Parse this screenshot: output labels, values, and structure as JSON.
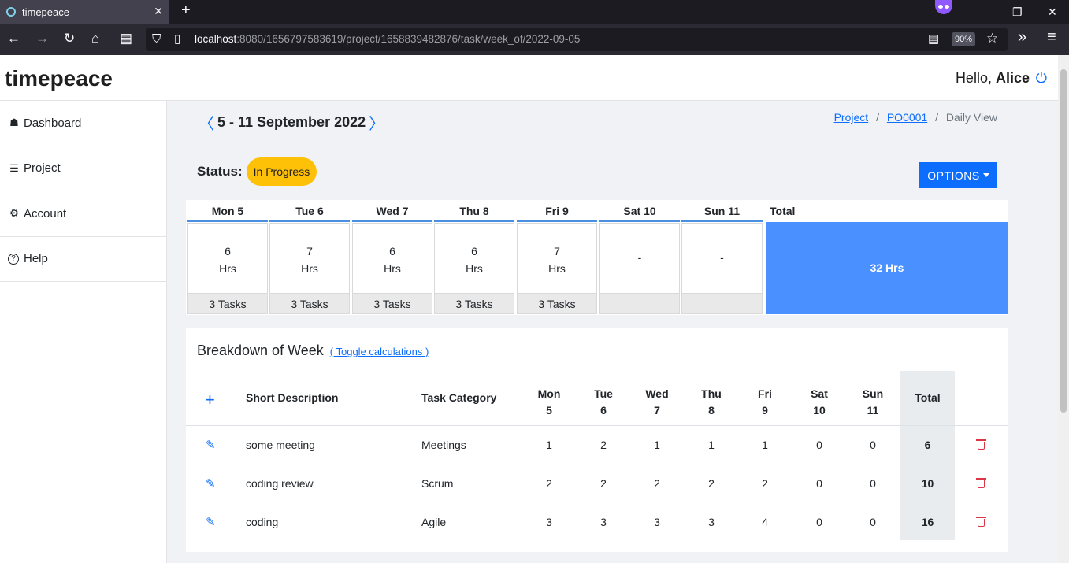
{
  "browser": {
    "tab_title": "timepeace",
    "tab_close": "✕",
    "new_tab": "+",
    "url_host": "localhost",
    "url_rest": ":8080/1656797583619/project/1658839482876/task/week_of/2022-09-05",
    "zoom": "90%",
    "back": "←",
    "forward": "→",
    "reload": "↻",
    "home": "⌂",
    "reader": "▤",
    "shield": "⛉",
    "page": "▯",
    "reader_view": "▤",
    "star": "☆",
    "more": "»",
    "menu": "≡",
    "minimize": "—",
    "restore": "❐",
    "close": "✕"
  },
  "app": {
    "brand": "timepeace",
    "hello": "Hello, ",
    "user": "Alice",
    "logout_icon": "⏻"
  },
  "sidebar": {
    "items": [
      {
        "icon": "🏠",
        "label": "Dashboard"
      },
      {
        "icon": "☰",
        "label": "Project"
      },
      {
        "icon": "⚙",
        "label": "Account"
      },
      {
        "icon": "?",
        "label": "Help"
      }
    ]
  },
  "week": {
    "prev": "〈",
    "title": "5 - 11 September 2022",
    "next": "〉"
  },
  "breadcrumb": {
    "project": "Project",
    "sep1": "/",
    "po": "PO0001",
    "sep2": "/",
    "current": "Daily View"
  },
  "status": {
    "label": "Status:",
    "value": "In Progress",
    "color": "#ffc107"
  },
  "options_label": "OPTIONS",
  "days": [
    {
      "head": "Mon 5",
      "hours": "6",
      "unit": "Hrs",
      "tasks": "3 Tasks"
    },
    {
      "head": "Tue 6",
      "hours": "7",
      "unit": "Hrs",
      "tasks": "3 Tasks"
    },
    {
      "head": "Wed 7",
      "hours": "6",
      "unit": "Hrs",
      "tasks": "3 Tasks"
    },
    {
      "head": "Thu 8",
      "hours": "6",
      "unit": "Hrs",
      "tasks": "3 Tasks"
    },
    {
      "head": "Fri 9",
      "hours": "7",
      "unit": "Hrs",
      "tasks": "3 Tasks"
    },
    {
      "head": "Sat 10",
      "empty": "-",
      "tasks": ""
    },
    {
      "head": "Sun 11",
      "empty": "-",
      "tasks": ""
    }
  ],
  "week_total": {
    "head": "Total",
    "value": "32 Hrs",
    "color": "#4a90ff"
  },
  "breakdown": {
    "title": "Breakdown of Week",
    "toggle": "( Toggle calculations )",
    "add": "+",
    "headers": {
      "desc": "Short Description",
      "category": "Task Category",
      "days": [
        {
          "name": "Mon",
          "num": "5"
        },
        {
          "name": "Tue",
          "num": "6"
        },
        {
          "name": "Wed",
          "num": "7"
        },
        {
          "name": "Thu",
          "num": "8"
        },
        {
          "name": "Fri",
          "num": "9"
        },
        {
          "name": "Sat",
          "num": "10"
        },
        {
          "name": "Sun",
          "num": "11"
        }
      ],
      "total": "Total"
    },
    "rows": [
      {
        "desc": "some meeting",
        "category": "Meetings",
        "hours": [
          "1",
          "2",
          "1",
          "1",
          "1",
          "0",
          "0"
        ],
        "total": "6"
      },
      {
        "desc": "coding review",
        "category": "Scrum",
        "hours": [
          "2",
          "2",
          "2",
          "2",
          "2",
          "0",
          "0"
        ],
        "total": "10"
      },
      {
        "desc": "coding",
        "category": "Agile",
        "hours": [
          "3",
          "3",
          "3",
          "3",
          "4",
          "0",
          "0"
        ],
        "total": "16"
      }
    ],
    "edit_icon": "✎"
  }
}
